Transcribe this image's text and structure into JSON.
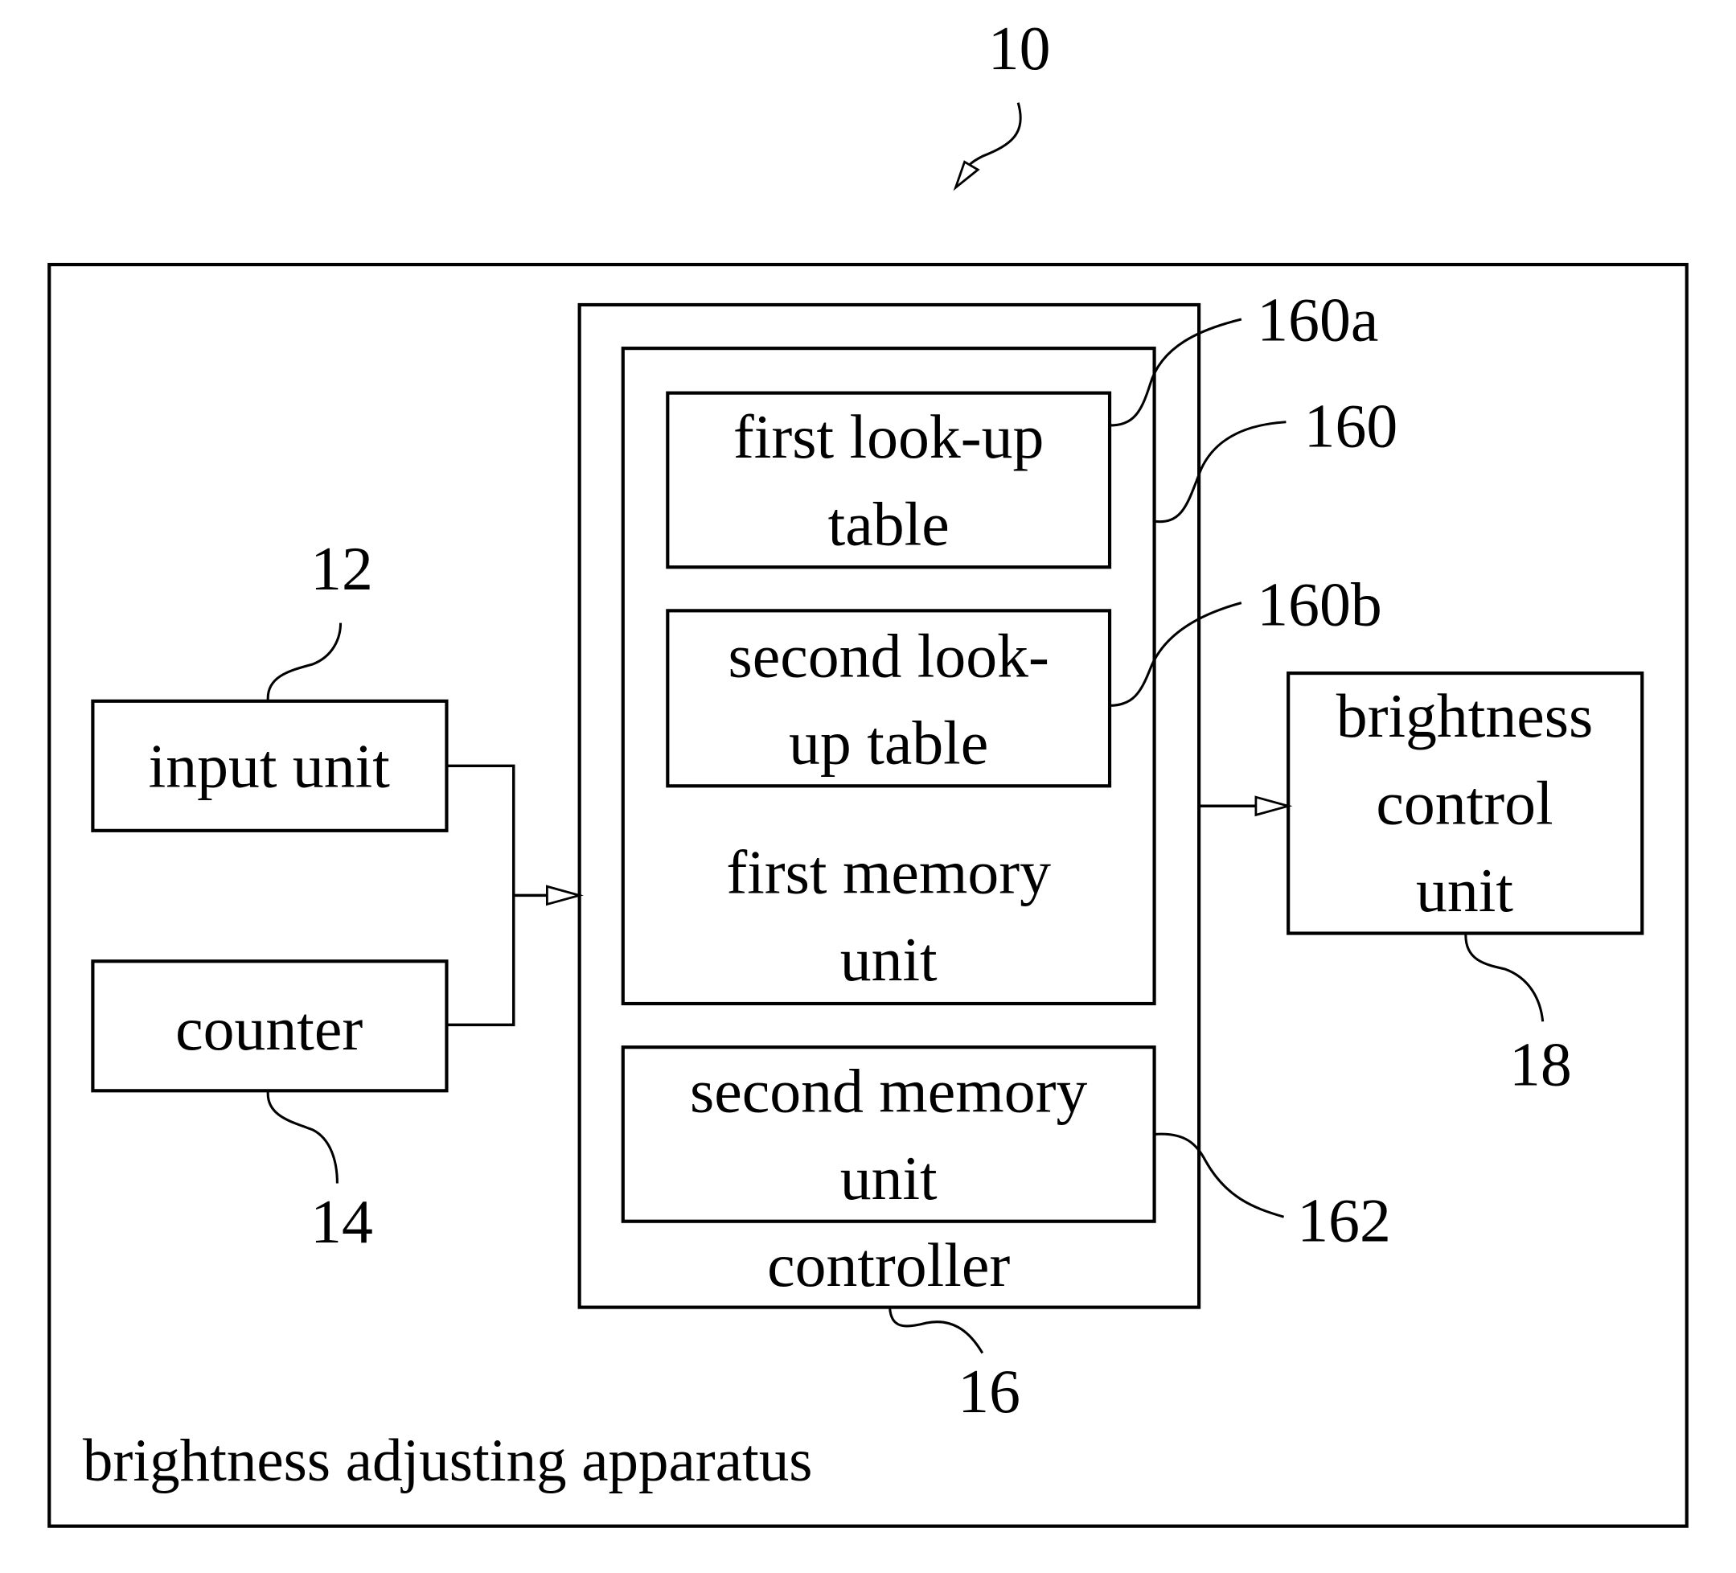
{
  "figure": {
    "reference": "10",
    "apparatus_label": "brightness adjusting apparatus"
  },
  "blocks": {
    "input_unit": {
      "label": "input unit",
      "ref": "12"
    },
    "counter": {
      "label": "counter",
      "ref": "14"
    },
    "controller": {
      "label": "controller",
      "ref": "16"
    },
    "first_memory_unit": {
      "label_lines": [
        "first memory",
        "unit"
      ],
      "ref": "160"
    },
    "first_lookup_table": {
      "label_lines": [
        "first look-up",
        "table"
      ],
      "ref": "160a"
    },
    "second_lookup_table": {
      "label_lines": [
        "second look-",
        "up table"
      ],
      "ref": "160b"
    },
    "second_memory_unit": {
      "label_lines": [
        "second memory",
        "unit"
      ],
      "ref": "162"
    },
    "brightness_control_unit": {
      "label_lines": [
        "brightness",
        "control",
        "unit"
      ],
      "ref": "18"
    }
  }
}
